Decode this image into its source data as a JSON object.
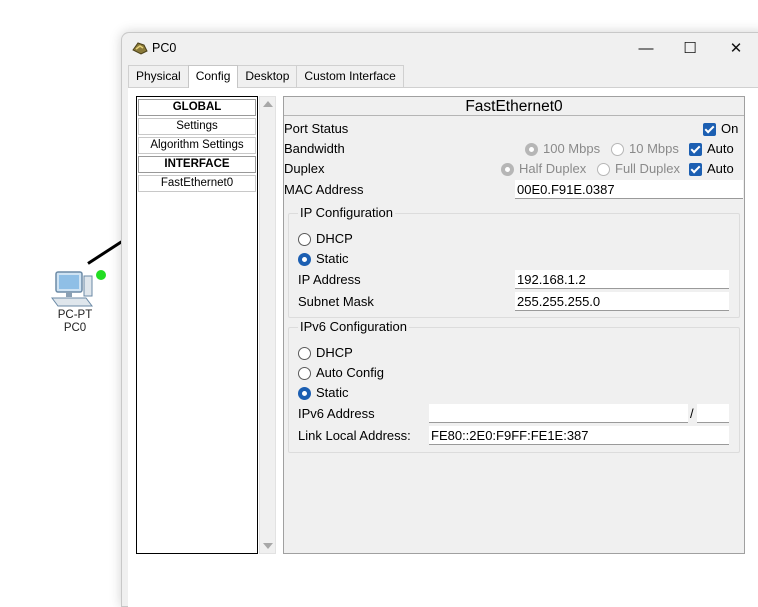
{
  "canvas": {
    "device_type_label": "PC-PT",
    "device_name_label": "PC0",
    "device_icon": "pc-computer-icon",
    "link_status_color": "#22dd22"
  },
  "window": {
    "title": "PC0",
    "title_icon": "packet-tracer-icon",
    "controls": {
      "minimize": "—",
      "maximize": "☐",
      "close": "✕"
    }
  },
  "tabs": [
    {
      "label": "Physical",
      "active": false
    },
    {
      "label": "Config",
      "active": true
    },
    {
      "label": "Desktop",
      "active": false
    },
    {
      "label": "Custom Interface",
      "active": false
    }
  ],
  "nav": {
    "global_header": "GLOBAL",
    "settings": "Settings",
    "algorithm_settings": "Algorithm Settings",
    "interface_header": "INTERFACE",
    "fastethernet": "FastEthernet0"
  },
  "interface": {
    "title": "FastEthernet0",
    "port_status": {
      "label": "Port Status",
      "on_label": "On",
      "on_checked": true
    },
    "bandwidth": {
      "label": "Bandwidth",
      "opt_100": "100 Mbps",
      "opt_10": "10 Mbps",
      "auto_label": "Auto",
      "auto_checked": true
    },
    "duplex": {
      "label": "Duplex",
      "opt_half": "Half Duplex",
      "opt_full": "Full Duplex",
      "auto_label": "Auto",
      "auto_checked": true
    },
    "mac": {
      "label": "MAC Address",
      "value": "00E0.F91E.0387"
    },
    "ip_config": {
      "title": "IP Configuration",
      "dhcp": "DHCP",
      "static": "Static",
      "selected": "Static",
      "ip_label": "IP Address",
      "ip_value": "192.168.1.2",
      "mask_label": "Subnet Mask",
      "mask_value": "255.255.255.0"
    },
    "ipv6_config": {
      "title": "IPv6 Configuration",
      "dhcp": "DHCP",
      "auto_config": "Auto Config",
      "static": "Static",
      "selected": "Static",
      "address_label": "IPv6 Address",
      "address_value": "",
      "prefix_separator": "/",
      "prefix_value": "",
      "link_local_label": "Link Local Address:",
      "link_local_value": "FE80::2E0:F9FF:FE1E:387"
    }
  },
  "colors": {
    "accent": "#1c5fb2",
    "window_bg": "#f0f0f0"
  }
}
